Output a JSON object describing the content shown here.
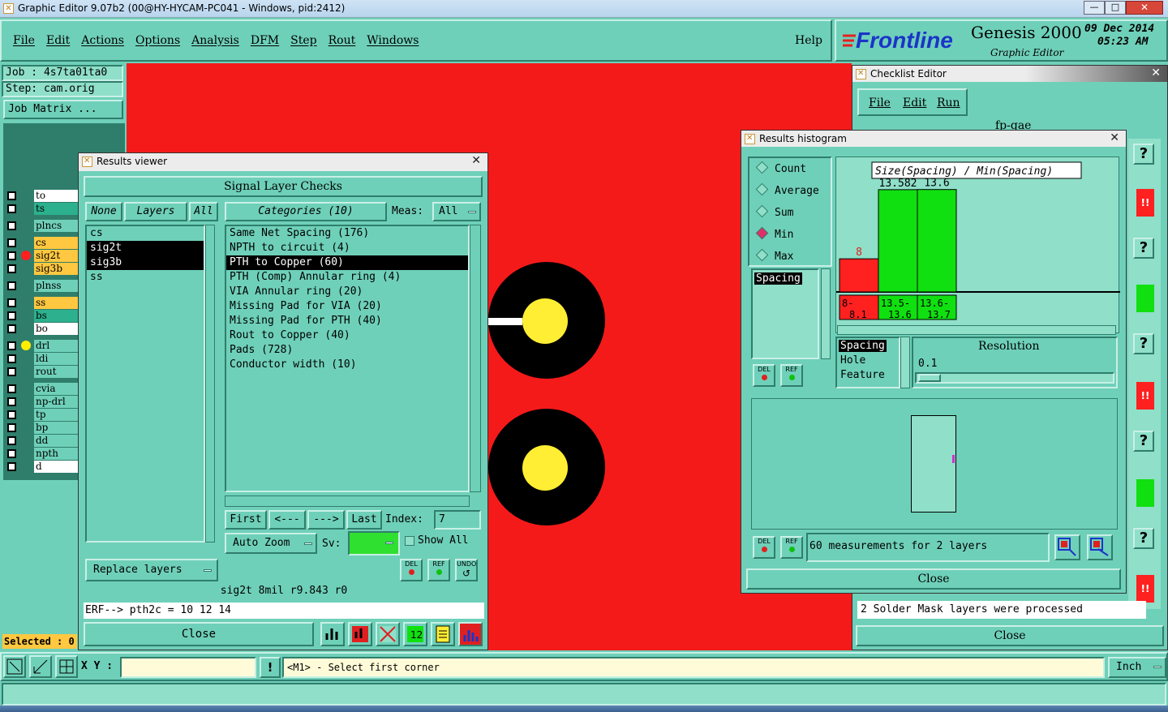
{
  "window": {
    "title": "Graphic Editor 9.07b2 (00@HY-HYCAM-PC041 - Windows, pid:2412)"
  },
  "menu": {
    "items": [
      "File",
      "Edit",
      "Actions",
      "Options",
      "Analysis",
      "DFM",
      "Step",
      "Rout",
      "Windows"
    ],
    "help": "Help"
  },
  "brand": {
    "logo": "Frontline",
    "product": "Genesis 2000",
    "subtitle": "Graphic Editor",
    "date": "09 Dec 2014",
    "time": "05:23 AM"
  },
  "job": {
    "job": "Job : 4s7ta01ta0",
    "step": "Step: cam.orig",
    "matrix": "Job Matrix ..."
  },
  "layers": [
    {
      "name": "to",
      "color": "#ffffff",
      "dot": ""
    },
    {
      "name": "ts",
      "color": "#2cb08e",
      "dot": ""
    },
    {
      "name": "plncs",
      "color": "#6fd0b9",
      "dot": ""
    },
    {
      "name": "cs",
      "color": "#ffc840",
      "dot": ""
    },
    {
      "name": "sig2t",
      "color": "#ffc840",
      "dot": "#ff2020"
    },
    {
      "name": "sig3b",
      "color": "#ffc840",
      "dot": ""
    },
    {
      "name": "plnss",
      "color": "#6fd0b9",
      "dot": ""
    },
    {
      "name": "ss",
      "color": "#ffc840",
      "dot": ""
    },
    {
      "name": "bs",
      "color": "#2cb08e",
      "dot": ""
    },
    {
      "name": "bo",
      "color": "#ffffff",
      "dot": ""
    },
    {
      "name": "drl",
      "color": "#6fd0b9",
      "dot": "#ffee00"
    },
    {
      "name": "ldi",
      "color": "#6fd0b9",
      "dot": ""
    },
    {
      "name": "rout",
      "color": "#6fd0b9",
      "dot": ""
    },
    {
      "name": "cvia",
      "color": "#6fd0b9",
      "dot": ""
    },
    {
      "name": "np-drl",
      "color": "#6fd0b9",
      "dot": ""
    },
    {
      "name": "tp",
      "color": "#6fd0b9",
      "dot": ""
    },
    {
      "name": "bp",
      "color": "#6fd0b9",
      "dot": ""
    },
    {
      "name": "dd",
      "color": "#6fd0b9",
      "dot": ""
    },
    {
      "name": "npth",
      "color": "#6fd0b9",
      "dot": ""
    },
    {
      "name": "d",
      "color": "#ffffff",
      "dot": ""
    }
  ],
  "selected": "Selected : 0",
  "results_viewer": {
    "title": "Results viewer",
    "header": "Signal Layer Checks",
    "none": "None",
    "layers_btn": "Layers",
    "all": "All",
    "categories_btn": "Categories (10)",
    "meas_label": "Meas:",
    "meas_value": "All",
    "layer_list": [
      "cs",
      "sig2t",
      "sig3b",
      "ss"
    ],
    "categories": [
      "Same Net Spacing (176)",
      "NPTH to circuit (4)",
      "PTH to Copper (60)",
      "PTH (Comp) Annular ring (4)",
      "VIA Annular ring (20)",
      "Missing Pad for VIA (20)",
      "Missing Pad for PTH (40)",
      "Rout to Copper (40)",
      "Pads (728)",
      "Conductor width (10)"
    ],
    "nav": {
      "first": "First",
      "prev": "<---",
      "next": "--->",
      "last": "Last",
      "index_label": "Index:",
      "index_value": "7"
    },
    "auto_zoom": "Auto Zoom",
    "sv_label": "Sv:",
    "show_all": "Show All",
    "replace_layers": "Replace layers",
    "del": "DEL",
    "ref": "REF",
    "undo": "UNDO",
    "status": "sig2t 8mil  r9.843  r0",
    "erf": "ERF--> pth2c = 10 12 14",
    "close": "Close"
  },
  "histogram": {
    "title": "Results histogram",
    "modes": [
      "Count",
      "Average",
      "Sum",
      "Min",
      "Max"
    ],
    "mode_selected": "Min",
    "measure_list": [
      "Spacing"
    ],
    "chart_title": "Size(Spacing) / Min(Spacing)",
    "bars": [
      {
        "label": "8",
        "range": "8-\n8.1",
        "value": 8,
        "color": "#ff2020"
      },
      {
        "label": "13.582",
        "range": "13.5-\n13.6",
        "value": 13.582,
        "color": "#10e010"
      },
      {
        "label": "13.6",
        "range": "13.6-\n13.7",
        "value": 13.6,
        "color": "#10e010"
      }
    ],
    "types": [
      "Spacing",
      "Hole",
      "Feature"
    ],
    "resolution_label": "Resolution",
    "resolution_value": "0.1",
    "measurements": "60 measurements for 2 layers",
    "close": "Close",
    "del": "DEL",
    "ref": "REF"
  },
  "checklist": {
    "title": "Checklist Editor",
    "menu": [
      "File",
      "Edit",
      "Run"
    ],
    "name": "fp-gae",
    "message": "2 Solder Mask layers were processed",
    "close": "Close"
  },
  "bottom": {
    "xy_label": "X Y :",
    "prompt": "<M1> - Select first corner",
    "units": "Inch"
  }
}
